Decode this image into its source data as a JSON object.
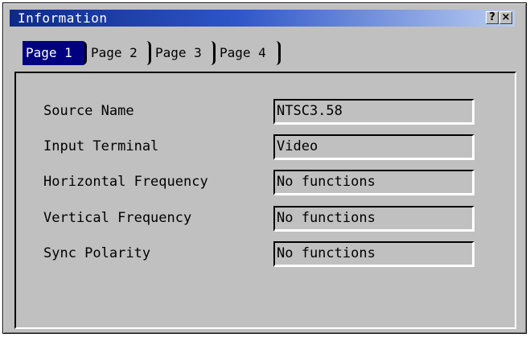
{
  "window": {
    "title": "Information",
    "help_label": "?",
    "close_label": "×"
  },
  "tabs": [
    {
      "label": "Page 1",
      "active": true
    },
    {
      "label": "Page 2",
      "active": false
    },
    {
      "label": "Page 3",
      "active": false
    },
    {
      "label": "Page 4",
      "active": false
    }
  ],
  "fields": [
    {
      "label": "Source Name",
      "value": "NTSC3.58"
    },
    {
      "label": "Input Terminal",
      "value": "Video"
    },
    {
      "label": "Horizontal Frequency",
      "value": "No functions"
    },
    {
      "label": "Vertical Frequency",
      "value": "No functions"
    },
    {
      "label": "Sync Polarity",
      "value": "No functions"
    }
  ],
  "colors": {
    "title_gradient_start": "#0e2a86",
    "title_gradient_end": "#b9cdf2",
    "active_tab": "#000080",
    "background": "#c0c0c0"
  }
}
